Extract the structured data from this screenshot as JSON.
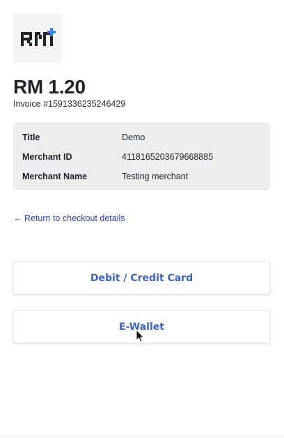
{
  "logo": {
    "text": "RM",
    "icon": "rm-logo-icon",
    "accent_color": "#2e8fe0",
    "text_color": "#1f2328"
  },
  "payment": {
    "amount": "RM 1.20",
    "invoice": "Invoice #1591336235246429"
  },
  "details": [
    {
      "label": "Title",
      "value": "Demo"
    },
    {
      "label": "Merchant ID",
      "value": "4118165203679668885"
    },
    {
      "label": "Merchant Name",
      "value": "Testing merchant"
    }
  ],
  "return_link": {
    "label": "← Return to checkout details"
  },
  "methods": [
    {
      "label": "Debit / Credit Card"
    },
    {
      "label": "E-Wallet"
    }
  ],
  "colors": {
    "link": "#2c3ea8",
    "button_text": "#3d63c5",
    "details_bg": "#eceeef"
  }
}
